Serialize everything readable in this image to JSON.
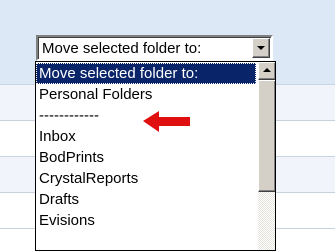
{
  "combo": {
    "value": "Move selected folder to:",
    "icon": "chevron-down-icon"
  },
  "dropdown": {
    "options": [
      {
        "label": "Move selected folder to:",
        "selected": true
      },
      {
        "label": "Personal Folders",
        "selected": false
      },
      {
        "label": "------------",
        "selected": false
      },
      {
        "label": "Inbox",
        "selected": false
      },
      {
        "label": "BodPrints",
        "selected": false
      },
      {
        "label": "CrystalReports",
        "selected": false
      },
      {
        "label": "Drafts",
        "selected": false
      },
      {
        "label": "Evisions",
        "selected": false
      }
    ]
  },
  "annotation": {
    "icon": "red-arrow-left-icon",
    "color": "#e01010"
  },
  "colors": {
    "selection": "#0a246a",
    "toolbar": "#dde8f7"
  }
}
